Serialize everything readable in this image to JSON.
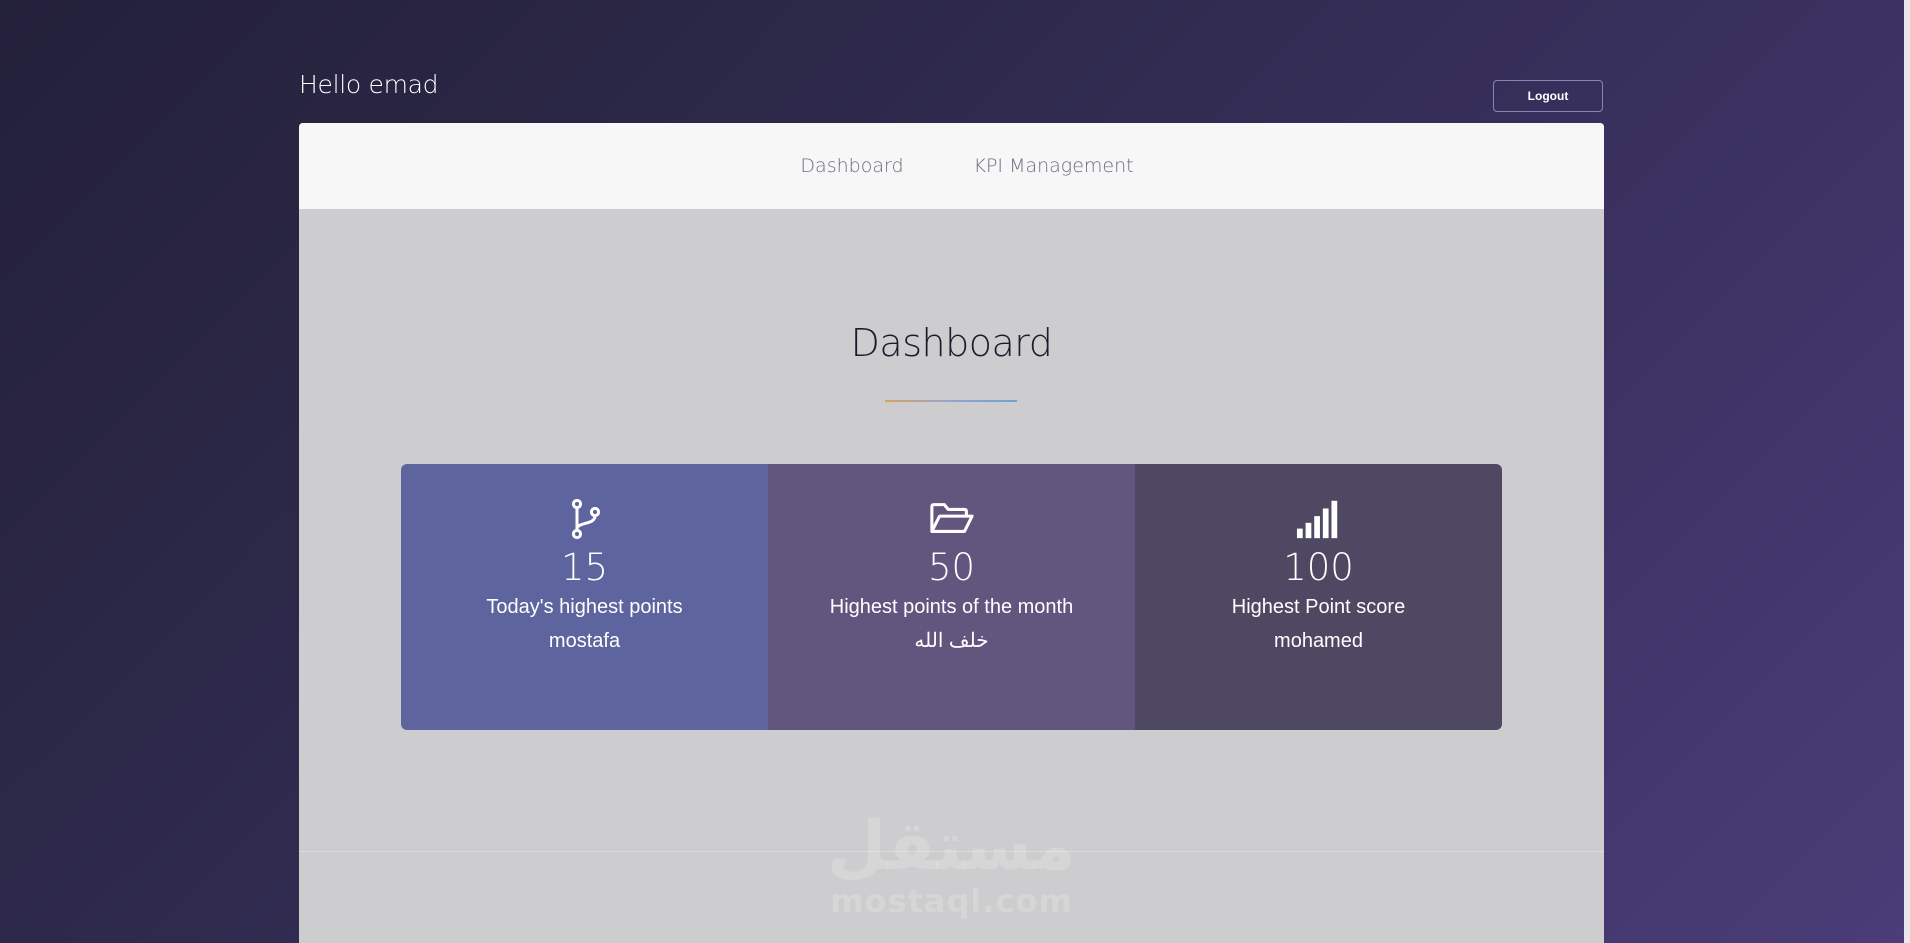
{
  "header": {
    "greeting": "Hello emad",
    "logout_label": "Logout"
  },
  "nav": {
    "items": [
      {
        "label": "Dashboard"
      },
      {
        "label": "KPI Management"
      }
    ]
  },
  "main": {
    "title": "Dashboard",
    "stats": [
      {
        "icon": "code-branch-icon",
        "value": "15",
        "label": "Today's highest points",
        "name": "mostafa",
        "color": "#5e659e"
      },
      {
        "icon": "folder-open-icon",
        "value": "50",
        "label": "Highest points of the month",
        "name": "خلف الله",
        "color": "#62567f"
      },
      {
        "icon": "signal-bars-icon",
        "value": "100",
        "label": "Highest Point score",
        "name": "mohamed",
        "color": "#4e4862"
      }
    ]
  },
  "watermark": {
    "logo": "مستقل",
    "text": "mostaql.com"
  }
}
